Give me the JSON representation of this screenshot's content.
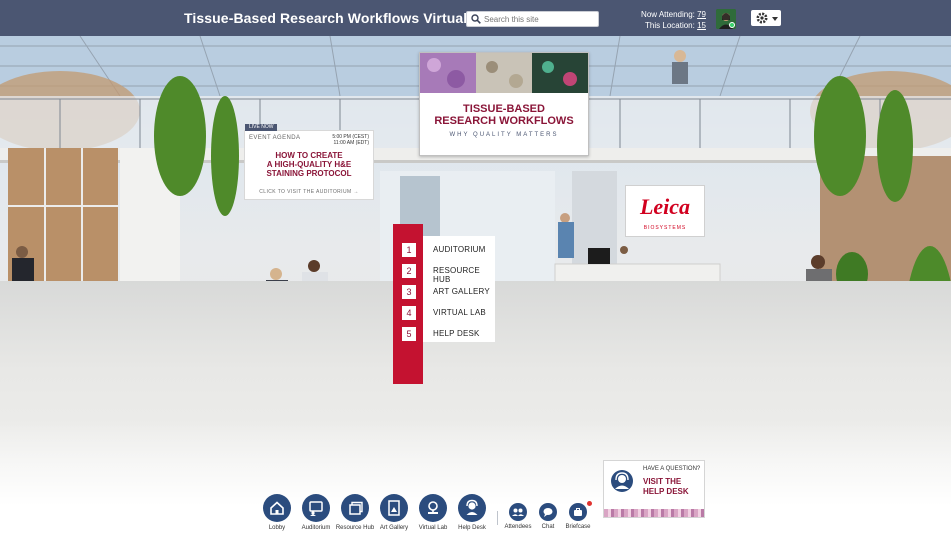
{
  "header": {
    "title": "Tissue-Based Research Workflows Virtual Event",
    "search_placeholder": "Search this site",
    "now_attending_label": "Now Attending:",
    "now_attending_count": "79",
    "this_location_label": "This Location:",
    "this_location_count": "15"
  },
  "agenda": {
    "live_badge": "LIVE NOW",
    "label": "EVENT AGENDA",
    "time_cest": "5:00 PM (CEST)",
    "time_edt": "11:00 AM (EDT)",
    "talk_line1": "HOW TO CREATE",
    "talk_line2": "A HIGH-QUALITY H&E",
    "talk_line3": "STAINING PROTOCOL",
    "cta": "CLICK TO VISIT THE AUDITORIUM →"
  },
  "banner": {
    "title_line1": "TISSUE-BASED",
    "title_line2": "RESEARCH WORKFLOWS",
    "subtitle": "WHY QUALITY MATTERS"
  },
  "sponsor": {
    "logo": "Leica",
    "sub": "BIOSYSTEMS"
  },
  "directory": [
    {
      "num": "1",
      "label": "AUDITORIUM"
    },
    {
      "num": "2",
      "label": "RESOURCE HUB"
    },
    {
      "num": "3",
      "label": "ART GALLERY"
    },
    {
      "num": "4",
      "label": "VIRTUAL LAB"
    },
    {
      "num": "5",
      "label": "HELP DESK"
    }
  ],
  "help_card": {
    "question": "HAVE A QUESTION?",
    "line1": "VISIT THE",
    "line2": "HELP DESK"
  },
  "nav": {
    "lobby": "Lobby",
    "auditorium": "Auditorium",
    "resource_hub": "Resource Hub",
    "art_gallery": "Art Gallery",
    "virtual_lab": "Virtual Lab",
    "help_desk": "Help Desk",
    "attendees": "Attendees",
    "chat": "Chat",
    "briefcase": "Briefcase"
  },
  "icons": {
    "search": "search-icon",
    "settings": "gear-icon",
    "lobby": "home-icon",
    "auditorium": "presentation-icon",
    "resource_hub": "stack-icon",
    "art_gallery": "frame-icon",
    "virtual_lab": "microscope-icon",
    "help_desk": "headset-icon",
    "attendees": "people-icon",
    "chat": "chat-icon",
    "briefcase": "briefcase-icon"
  },
  "colors": {
    "header_bg": "#4b5672",
    "brand_maroon": "#8a1538",
    "nav_blue": "#2b4c7e",
    "accent_red": "#c41230"
  }
}
